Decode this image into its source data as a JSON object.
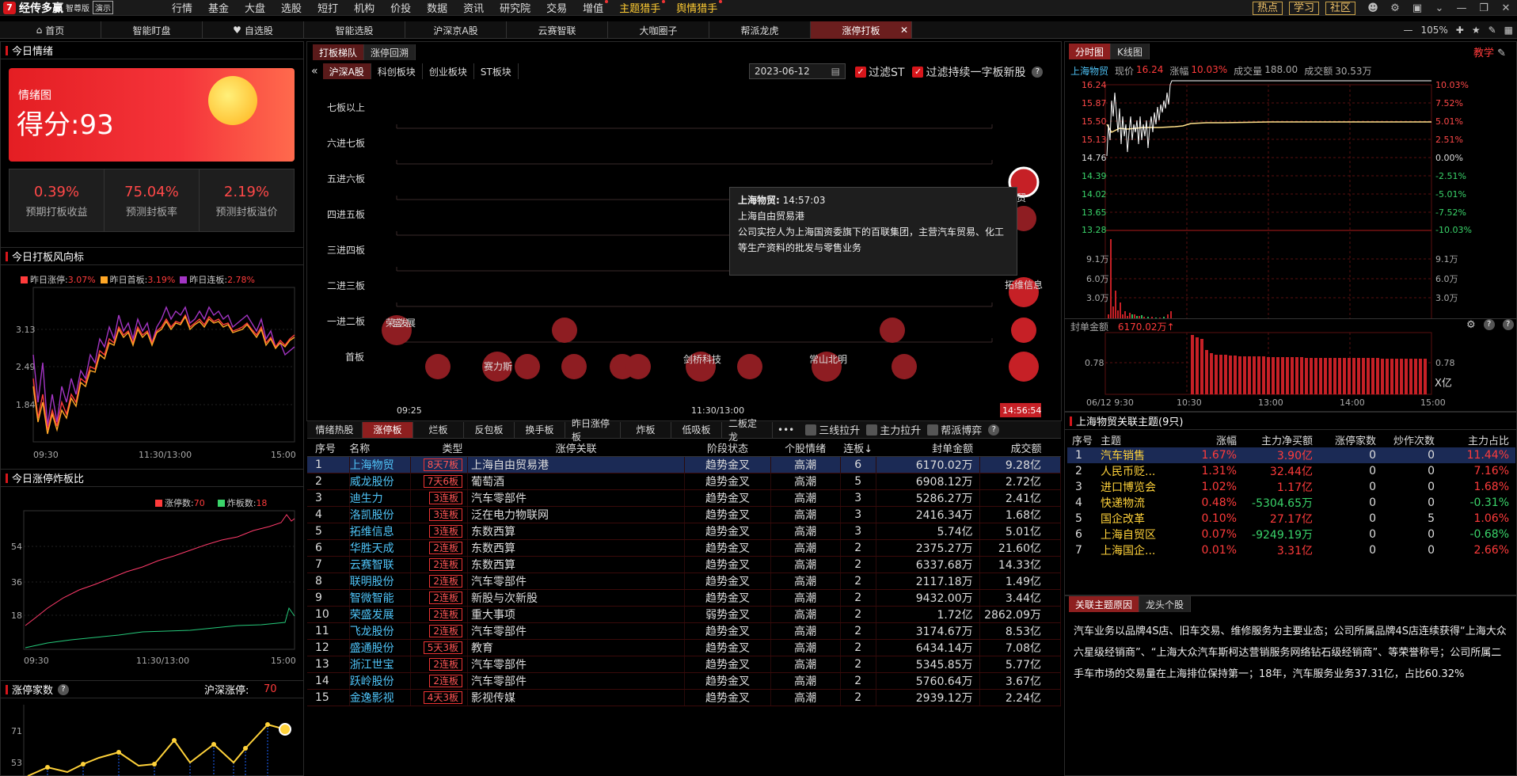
{
  "app": {
    "name": "经传多赢",
    "edition": "智尊版",
    "demo": "演示"
  },
  "menu": [
    "行情",
    "基金",
    "大盘",
    "选股",
    "短打",
    "机构",
    "价投",
    "数据",
    "资讯",
    "研究院",
    "交易",
    "增值",
    "主题猎手",
    "舆情猎手"
  ],
  "menu_right": {
    "hot": "热点",
    "study": "学习",
    "community": "社区"
  },
  "tabs": [
    "首页",
    "智能盯盘",
    "自选股",
    "智能选股",
    "沪深京A股",
    "云赛智联",
    "大咖圈子",
    "帮派龙虎",
    "涨停打板"
  ],
  "tab_right": {
    "zoom": "105%"
  },
  "left": {
    "mood_title": "今日情绪",
    "mood_label": "情绪图",
    "mood_score": "得分:93",
    "stats": [
      {
        "value": "0.39%",
        "label": "预期打板收益"
      },
      {
        "value": "75.04%",
        "label": "预测封板率"
      },
      {
        "value": "2.19%",
        "label": "预测封板溢价"
      }
    ],
    "wind_title": "今日打板风向标",
    "wind_legend": [
      {
        "name": "昨日涨停:",
        "value": "3.07%",
        "color": "#ff3b3b"
      },
      {
        "name": "昨日首板:",
        "value": "3.19%",
        "color": "#ffa726"
      },
      {
        "name": "昨日连板:",
        "value": "2.78%",
        "color": "#a335c4"
      }
    ],
    "wind_yticks": [
      "3.13",
      "2.49",
      "1.84"
    ],
    "time_ticks": [
      "09:30",
      "11:30/13:00",
      "15:00"
    ],
    "ratio_title": "今日涨停炸板比",
    "ratio_legend": [
      {
        "name": "涨停数:",
        "value": "70",
        "color": "#ff3b3b"
      },
      {
        "name": "炸板数:",
        "value": "18",
        "color": "#3ad46a"
      }
    ],
    "ratio_yticks": [
      "54",
      "36",
      "18"
    ],
    "count_title": "涨停家数",
    "count_label": "沪深涨停:",
    "count_value": "70",
    "count_yticks": [
      "71",
      "53"
    ]
  },
  "middle": {
    "top_tabs": [
      "打板梯队",
      "涨停回溯"
    ],
    "market_tabs": [
      "沪深A股",
      "科创板块",
      "创业板块",
      "ST板块"
    ],
    "date": "2023-06-12",
    "filter1": "过滤ST",
    "filter2": "过滤持续一字板新股",
    "ladder_levels": [
      "七板以上",
      "六进七板",
      "五进六板",
      "四进五板",
      "三进四板",
      "二进三板",
      "一进二板",
      "首板"
    ],
    "x_start": "09:25",
    "x_mid": "11:30/13:00",
    "x_end": "14:56:54",
    "bubble_labels": {
      "b1": "荣盛发展",
      "b2": "赛力斯",
      "b3": "剑桥科技",
      "b4": "常山北明",
      "b5": "拓维信息",
      "b6": "贸"
    },
    "tooltip": {
      "name": "上海物贸:",
      "time": "14:57:03",
      "theme": "上海自由贸易港",
      "desc": "公司实控人为上海国资委旗下的百联集团，主营汽车贸易、化工等生产资料的批发与零售业务"
    },
    "bottom_tabs": [
      "情绪热股",
      "涨停板",
      "烂板",
      "反包板",
      "换手板",
      "昨日涨停板",
      "炸板",
      "低吸板",
      "二板定龙"
    ],
    "bottom_more": "•••",
    "bottom_checks": [
      "三线拉升",
      "主力拉升",
      "帮派博弈"
    ],
    "columns": [
      "序号",
      "名称",
      "类型",
      "涨停关联",
      "阶段状态",
      "个股情绪",
      "连板↓",
      "封单金额",
      "成交额"
    ],
    "rows": [
      [
        "1",
        "上海物贸",
        "8天7板",
        "上海自由贸易港",
        "趋势金叉",
        "高潮",
        "6",
        "6170.02万",
        "9.28亿"
      ],
      [
        "2",
        "威龙股份",
        "7天6板",
        "葡萄酒",
        "趋势金叉",
        "高潮",
        "5",
        "6908.12万",
        "2.72亿"
      ],
      [
        "3",
        "迪生力",
        "3连板",
        "汽车零部件",
        "趋势金叉",
        "高潮",
        "3",
        "5286.27万",
        "2.41亿"
      ],
      [
        "4",
        "洛凯股份",
        "3连板",
        "泛在电力物联网",
        "趋势金叉",
        "高潮",
        "3",
        "2416.34万",
        "1.68亿"
      ],
      [
        "5",
        "拓维信息",
        "3连板",
        "东数西算",
        "趋势金叉",
        "高潮",
        "3",
        "5.74亿",
        "5.01亿"
      ],
      [
        "6",
        "华胜天成",
        "2连板",
        "东数西算",
        "趋势金叉",
        "高潮",
        "2",
        "2375.27万",
        "21.60亿"
      ],
      [
        "7",
        "云赛智联",
        "2连板",
        "东数西算",
        "趋势金叉",
        "高潮",
        "2",
        "6337.68万",
        "14.33亿"
      ],
      [
        "8",
        "联明股份",
        "2连板",
        "汽车零部件",
        "趋势金叉",
        "高潮",
        "2",
        "2117.18万",
        "1.49亿"
      ],
      [
        "9",
        "智微智能",
        "2连板",
        "新股与次新股",
        "趋势金叉",
        "高潮",
        "2",
        "9432.00万",
        "3.44亿"
      ],
      [
        "10",
        "荣盛发展",
        "2连板",
        "重大事项",
        "弱势金叉",
        "高潮",
        "2",
        "1.72亿",
        "2862.09万"
      ],
      [
        "11",
        "飞龙股份",
        "2连板",
        "汽车零部件",
        "趋势金叉",
        "高潮",
        "2",
        "3174.67万",
        "8.53亿"
      ],
      [
        "12",
        "盛通股份",
        "5天3板",
        "教育",
        "趋势金叉",
        "高潮",
        "2",
        "6434.14万",
        "7.08亿"
      ],
      [
        "13",
        "浙江世宝",
        "2连板",
        "汽车零部件",
        "趋势金叉",
        "高潮",
        "2",
        "5345.85万",
        "5.77亿"
      ],
      [
        "14",
        "跃岭股份",
        "2连板",
        "汽车零部件",
        "趋势金叉",
        "高潮",
        "2",
        "5760.64万",
        "3.67亿"
      ],
      [
        "15",
        "金逸影视",
        "4天3板",
        "影视传媒",
        "趋势金叉",
        "高潮",
        "2",
        "2939.12万",
        "2.24亿"
      ]
    ]
  },
  "right": {
    "tabs": [
      "分时图",
      "K线图"
    ],
    "teach": "教学",
    "quote": {
      "name": "上海物贸",
      "price_label": "现价",
      "price": "16.24",
      "chg_label": "涨幅",
      "chg": "10.03%",
      "vol_label": "成交量",
      "vol": "188.00",
      "amt_label": "成交额",
      "amt": "30.53万"
    },
    "price_ticks": [
      "16.24",
      "15.87",
      "15.50",
      "15.13",
      "14.76",
      "14.39",
      "14.02",
      "13.65",
      "13.28"
    ],
    "pct_ticks": [
      "10.03%",
      "7.52%",
      "5.01%",
      "2.51%",
      "0.00%",
      "-2.51%",
      "-5.01%",
      "-7.52%",
      "-10.03%"
    ],
    "vol_ticks": [
      "9.1万",
      "6.0万",
      "3.0万"
    ],
    "seal_label": "封单金额",
    "seal_value": "6170.02万",
    "seal_tick": "0.78",
    "seal_unit": "X亿",
    "time_ticks": [
      "06/12 9:30",
      "10:30",
      "13:00",
      "14:00",
      "15:00"
    ],
    "theme_title": "上海物贸关联主题(9只)",
    "theme_cols": [
      "序号",
      "主题",
      "涨幅",
      "主力净买额",
      "涨停家数",
      "炒作次数",
      "主力占比"
    ],
    "themes": [
      [
        "1",
        "汽车销售",
        "1.67%",
        "3.90亿",
        "0",
        "0",
        "11.44%"
      ],
      [
        "2",
        "人民币贬...",
        "1.31%",
        "32.44亿",
        "0",
        "0",
        "7.16%"
      ],
      [
        "3",
        "进口博览会",
        "1.02%",
        "1.17亿",
        "0",
        "0",
        "1.68%"
      ],
      [
        "4",
        "快递物流",
        "0.48%",
        "-5304.65万",
        "0",
        "0",
        "-0.31%"
      ],
      [
        "5",
        "国企改革",
        "0.10%",
        "27.17亿",
        "0",
        "5",
        "1.06%"
      ],
      [
        "6",
        "上海自贸区",
        "0.07%",
        "-9249.19万",
        "0",
        "0",
        "-0.68%"
      ],
      [
        "7",
        "上海国企...",
        "0.01%",
        "3.31亿",
        "0",
        "0",
        "2.66%"
      ]
    ],
    "reason_tabs": [
      "关联主题原因",
      "龙头个股"
    ],
    "reason_text": "汽车业务以品牌4S店、旧车交易、维修服务为主要业态；公司所属品牌4S店连续获得“上海大众六星级经销商”、“上海大众汽车斯柯达营销服务网络钻石级经销商”、等荣誉称号；公司所属二手车市场的交易量在上海排位保持第一；18年，汽车服务业务37.31亿，占比60.32%"
  }
}
